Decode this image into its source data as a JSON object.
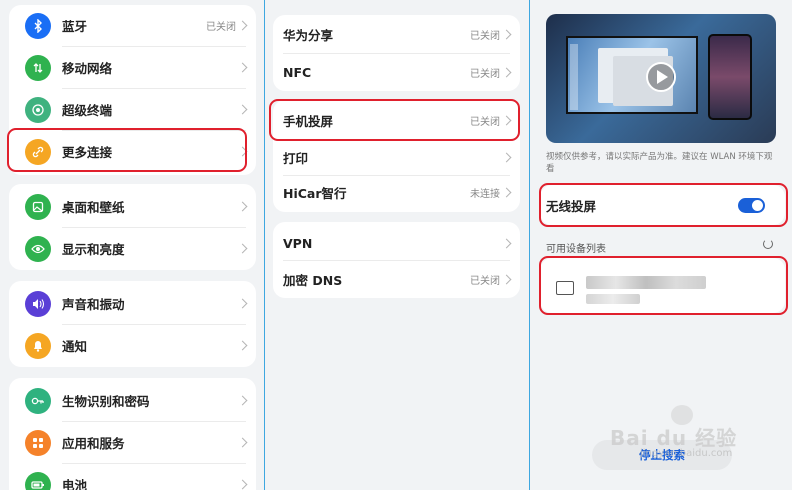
{
  "left_panel": {
    "groups": [
      [
        {
          "label": "蓝牙",
          "value": "已关闭",
          "icon": "bluetooth-icon",
          "color": "#1a6ef5"
        },
        {
          "label": "移动网络",
          "value": "",
          "icon": "mobile-network-icon",
          "color": "#2fb24f"
        },
        {
          "label": "超级终端",
          "value": "",
          "icon": "super-device-icon",
          "color": "#3fb27f"
        },
        {
          "label": "更多连接",
          "value": "",
          "icon": "link-icon",
          "color": "#f5a623"
        }
      ],
      [
        {
          "label": "桌面和壁纸",
          "value": "",
          "icon": "wallpaper-icon",
          "color": "#2fb24f"
        },
        {
          "label": "显示和亮度",
          "value": "",
          "icon": "eye-icon",
          "color": "#2fb24f"
        }
      ],
      [
        {
          "label": "声音和振动",
          "value": "",
          "icon": "speaker-icon",
          "color": "#5a3fd6"
        },
        {
          "label": "通知",
          "value": "",
          "icon": "bell-icon",
          "color": "#f5a623"
        }
      ],
      [
        {
          "label": "生物识别和密码",
          "value": "",
          "icon": "key-icon",
          "color": "#2fb27f"
        },
        {
          "label": "应用和服务",
          "value": "",
          "icon": "apps-icon",
          "color": "#f5822a"
        },
        {
          "label": "电池",
          "value": "",
          "icon": "battery-icon",
          "color": "#2fb24f"
        }
      ]
    ]
  },
  "middle_panel": {
    "groups": [
      [
        {
          "label": "华为分享",
          "value": "已关闭"
        },
        {
          "label": "NFC",
          "value": "已关闭"
        }
      ],
      [
        {
          "label": "手机投屏",
          "value": "已关闭"
        },
        {
          "label": "打印",
          "value": ""
        },
        {
          "label": "HiCar智行",
          "value": "未连接"
        }
      ],
      [
        {
          "label": "VPN",
          "value": ""
        },
        {
          "label": "加密 DNS",
          "value": "已关闭"
        }
      ]
    ]
  },
  "right_panel": {
    "note": "视频仅供参考，请以实际产品为准。建议在 WLAN 环境下观看",
    "wireless_label": "无线投屏",
    "wireless_enabled": true,
    "device_list_title": "可用设备列表",
    "stop_button": "停止搜索"
  },
  "watermark": {
    "main": "Bai du 经验",
    "sub": "jingyan.baidu.com"
  },
  "colors": {
    "highlight": "#e0202d",
    "accent": "#1a60d8",
    "divider": "#3ea7e0"
  }
}
